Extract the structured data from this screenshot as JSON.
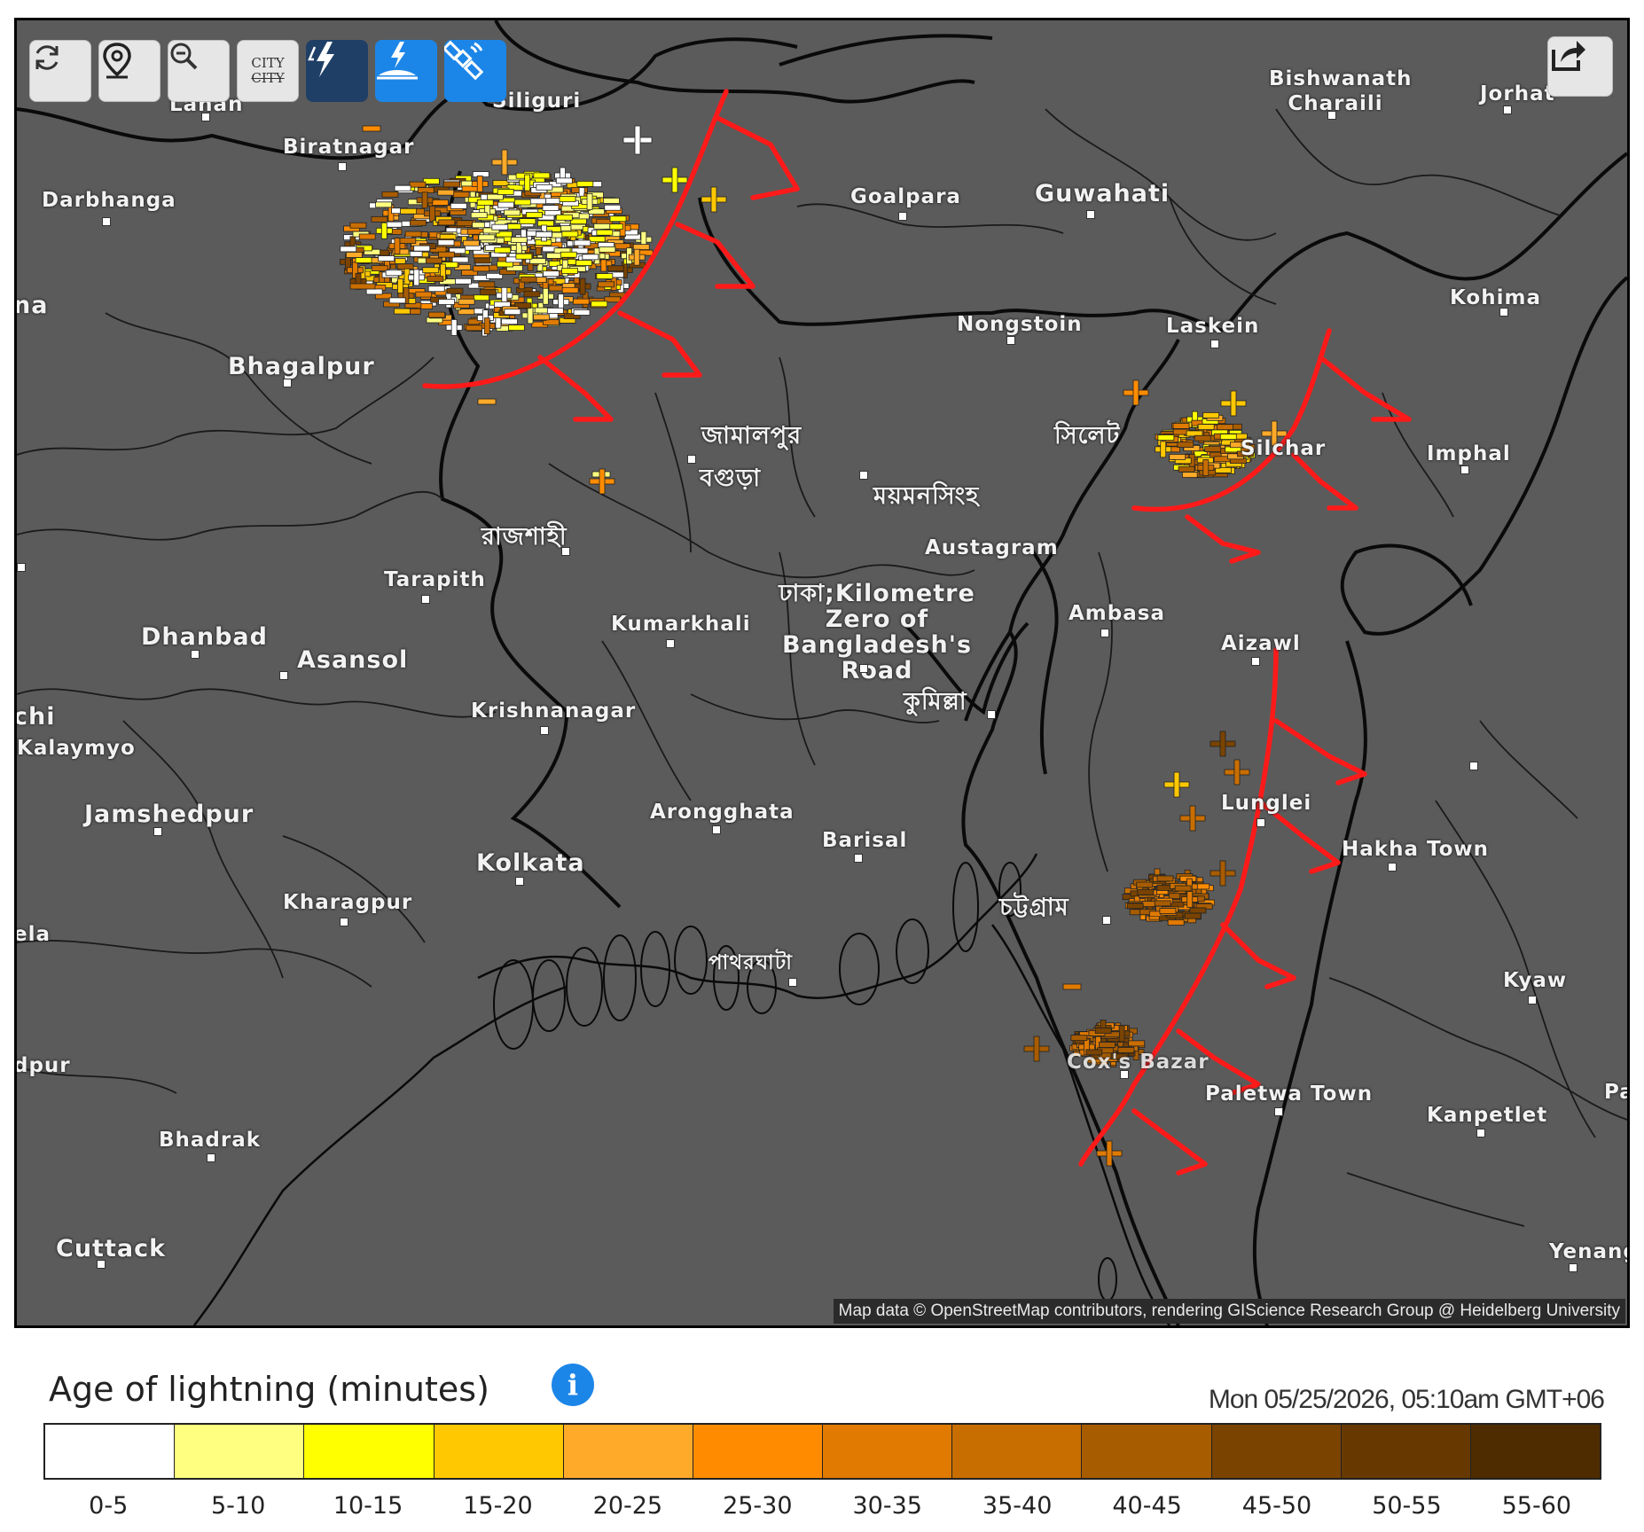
{
  "toolbar": {
    "buttons": [
      {
        "name": "refresh-button",
        "icon": "refresh-icon"
      },
      {
        "name": "locate-button",
        "icon": "location-pin-icon"
      },
      {
        "name": "zoom-out-button",
        "icon": "zoom-out-icon"
      },
      {
        "name": "toggle-city-labels-button",
        "icon": "city-labels-icon",
        "text_top": "CITY",
        "text_bottom": "CITY"
      },
      {
        "name": "lightning-layer-button",
        "icon": "lightning-icon"
      },
      {
        "name": "lightning-ground-button",
        "icon": "lightning-strike-icon"
      },
      {
        "name": "satellite-button",
        "icon": "satellite-icon"
      }
    ],
    "share_icon": "share-icon"
  },
  "map": {
    "background_color": "#5b5b5b",
    "attribution": "Map data © OpenStreetMap contributors, rendering GIScience Research Group @ Heidelberg University",
    "cities": [
      {
        "name": "Biratnagar"
      },
      {
        "name": "Siliguri"
      },
      {
        "name": "Lahan"
      },
      {
        "name": "Darbhanga"
      },
      {
        "name": "Goalpara"
      },
      {
        "name": "Guwahati"
      },
      {
        "name": "Bishwanath Charaili"
      },
      {
        "name": "Jorhat"
      },
      {
        "name": "Kohima"
      },
      {
        "name": "Nongstoin"
      },
      {
        "name": "Laskein"
      },
      {
        "name": "Imphal"
      },
      {
        "name": "Bhagalpur"
      },
      {
        "name": "জামালপুর"
      },
      {
        "name": "বগুড়া"
      },
      {
        "name": "ময়মনসিংহ"
      },
      {
        "name": "সিলেট"
      },
      {
        "name": "Silchar"
      },
      {
        "name": "রাজশাহী"
      },
      {
        "name": "Austagram"
      },
      {
        "name": "Tarapith"
      },
      {
        "name": "Dhanbad"
      },
      {
        "name": "Asansol"
      },
      {
        "name": "Kumarkhali"
      },
      {
        "name": "ঢাকা;Kilometre Zero of Bangladesh's Road"
      },
      {
        "name": "Ambasa"
      },
      {
        "name": "Aizawl"
      },
      {
        "name": "কুমিল্লা"
      },
      {
        "name": "Krishnanagar"
      },
      {
        "name": "Kalaymyo"
      },
      {
        "name": "Jamshedpur"
      },
      {
        "name": "Arongghata"
      },
      {
        "name": "Barisal"
      },
      {
        "name": "Lunglei"
      },
      {
        "name": "Kolkata"
      },
      {
        "name": "Hakha Town"
      },
      {
        "name": "Kharagpur"
      },
      {
        "name": "চট্টগ্রাম"
      },
      {
        "name": "পাথরঘাটা"
      },
      {
        "name": "Kyaw"
      },
      {
        "name": "Paletwa Town"
      },
      {
        "name": "Kanpetlet"
      },
      {
        "name": "Bhadrak"
      },
      {
        "name": "Cuttack"
      },
      {
        "name": "Yenang"
      },
      {
        "name": "Cox's Bazar"
      }
    ],
    "edge_labels": [
      "na",
      "chi",
      "ela",
      "dpur",
      "Pa"
    ]
  },
  "legend": {
    "title": "Age of lightning (minutes)",
    "info_icon": "info-icon",
    "timestamp": "Mon 05/25/2026, 05:10am GMT+06",
    "bins": [
      {
        "label": "0-5",
        "color": "#ffffff"
      },
      {
        "label": "5-10",
        "color": "#ffff80"
      },
      {
        "label": "10-15",
        "color": "#ffff00"
      },
      {
        "label": "15-20",
        "color": "#ffc800"
      },
      {
        "label": "20-25",
        "color": "#ffaa28"
      },
      {
        "label": "25-30",
        "color": "#ff8c00"
      },
      {
        "label": "30-35",
        "color": "#e07a00"
      },
      {
        "label": "35-40",
        "color": "#c86e00"
      },
      {
        "label": "40-45",
        "color": "#a85c00"
      },
      {
        "label": "45-50",
        "color": "#7a4300"
      },
      {
        "label": "50-55",
        "color": "#673900"
      },
      {
        "label": "55-60",
        "color": "#4f2c00"
      }
    ]
  },
  "annotations": {
    "color": "#ff1a1a"
  }
}
